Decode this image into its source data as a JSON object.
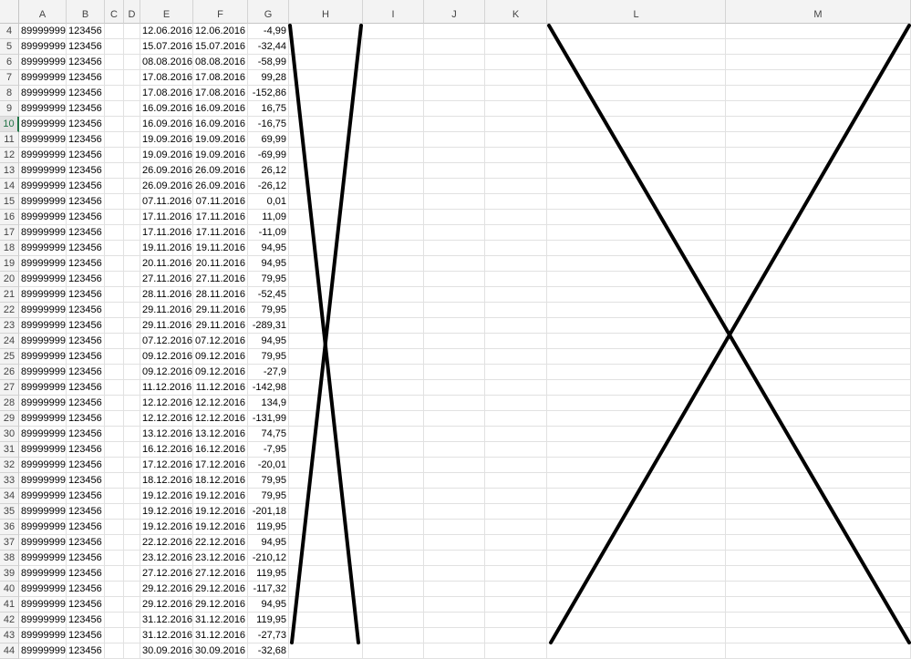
{
  "columns": [
    "A",
    "B",
    "C",
    "D",
    "E",
    "F",
    "G",
    "H",
    "I",
    "J",
    "K",
    "L",
    "M"
  ],
  "active_row": "10",
  "rows": [
    {
      "n": "4",
      "a": "89999999",
      "b": "123456",
      "e": "12.06.2016",
      "f": "12.06.2016",
      "g": "-4,99"
    },
    {
      "n": "5",
      "a": "89999999",
      "b": "123456",
      "e": "15.07.2016",
      "f": "15.07.2016",
      "g": "-32,44"
    },
    {
      "n": "6",
      "a": "89999999",
      "b": "123456",
      "e": "08.08.2016",
      "f": "08.08.2016",
      "g": "-58,99"
    },
    {
      "n": "7",
      "a": "89999999",
      "b": "123456",
      "e": "17.08.2016",
      "f": "17.08.2016",
      "g": "99,28"
    },
    {
      "n": "8",
      "a": "89999999",
      "b": "123456",
      "e": "17.08.2016",
      "f": "17.08.2016",
      "g": "-152,86"
    },
    {
      "n": "9",
      "a": "89999999",
      "b": "123456",
      "e": "16.09.2016",
      "f": "16.09.2016",
      "g": "16,75"
    },
    {
      "n": "10",
      "a": "89999999",
      "b": "123456",
      "e": "16.09.2016",
      "f": "16.09.2016",
      "g": "-16,75"
    },
    {
      "n": "11",
      "a": "89999999",
      "b": "123456",
      "e": "19.09.2016",
      "f": "19.09.2016",
      "g": "69,99"
    },
    {
      "n": "12",
      "a": "89999999",
      "b": "123456",
      "e": "19.09.2016",
      "f": "19.09.2016",
      "g": "-69,99"
    },
    {
      "n": "13",
      "a": "89999999",
      "b": "123456",
      "e": "26.09.2016",
      "f": "26.09.2016",
      "g": "26,12"
    },
    {
      "n": "14",
      "a": "89999999",
      "b": "123456",
      "e": "26.09.2016",
      "f": "26.09.2016",
      "g": "-26,12"
    },
    {
      "n": "15",
      "a": "89999999",
      "b": "123456",
      "e": "07.11.2016",
      "f": "07.11.2016",
      "g": "0,01"
    },
    {
      "n": "16",
      "a": "89999999",
      "b": "123456",
      "e": "17.11.2016",
      "f": "17.11.2016",
      "g": "11,09"
    },
    {
      "n": "17",
      "a": "89999999",
      "b": "123456",
      "e": "17.11.2016",
      "f": "17.11.2016",
      "g": "-11,09"
    },
    {
      "n": "18",
      "a": "89999999",
      "b": "123456",
      "e": "19.11.2016",
      "f": "19.11.2016",
      "g": "94,95"
    },
    {
      "n": "19",
      "a": "89999999",
      "b": "123456",
      "e": "20.11.2016",
      "f": "20.11.2016",
      "g": "94,95"
    },
    {
      "n": "20",
      "a": "89999999",
      "b": "123456",
      "e": "27.11.2016",
      "f": "27.11.2016",
      "g": "79,95"
    },
    {
      "n": "21",
      "a": "89999999",
      "b": "123456",
      "e": "28.11.2016",
      "f": "28.11.2016",
      "g": "-52,45"
    },
    {
      "n": "22",
      "a": "89999999",
      "b": "123456",
      "e": "29.11.2016",
      "f": "29.11.2016",
      "g": "79,95"
    },
    {
      "n": "23",
      "a": "89999999",
      "b": "123456",
      "e": "29.11.2016",
      "f": "29.11.2016",
      "g": "-289,31"
    },
    {
      "n": "24",
      "a": "89999999",
      "b": "123456",
      "e": "07.12.2016",
      "f": "07.12.2016",
      "g": "94,95"
    },
    {
      "n": "25",
      "a": "89999999",
      "b": "123456",
      "e": "09.12.2016",
      "f": "09.12.2016",
      "g": "79,95"
    },
    {
      "n": "26",
      "a": "89999999",
      "b": "123456",
      "e": "09.12.2016",
      "f": "09.12.2016",
      "g": "-27,9"
    },
    {
      "n": "27",
      "a": "89999999",
      "b": "123456",
      "e": "11.12.2016",
      "f": "11.12.2016",
      "g": "-142,98"
    },
    {
      "n": "28",
      "a": "89999999",
      "b": "123456",
      "e": "12.12.2016",
      "f": "12.12.2016",
      "g": "134,9"
    },
    {
      "n": "29",
      "a": "89999999",
      "b": "123456",
      "e": "12.12.2016",
      "f": "12.12.2016",
      "g": "-131,99"
    },
    {
      "n": "30",
      "a": "89999999",
      "b": "123456",
      "e": "13.12.2016",
      "f": "13.12.2016",
      "g": "74,75"
    },
    {
      "n": "31",
      "a": "89999999",
      "b": "123456",
      "e": "16.12.2016",
      "f": "16.12.2016",
      "g": "-7,95"
    },
    {
      "n": "32",
      "a": "89999999",
      "b": "123456",
      "e": "17.12.2016",
      "f": "17.12.2016",
      "g": "-20,01"
    },
    {
      "n": "33",
      "a": "89999999",
      "b": "123456",
      "e": "18.12.2016",
      "f": "18.12.2016",
      "g": "79,95"
    },
    {
      "n": "34",
      "a": "89999999",
      "b": "123456",
      "e": "19.12.2016",
      "f": "19.12.2016",
      "g": "79,95"
    },
    {
      "n": "35",
      "a": "89999999",
      "b": "123456",
      "e": "19.12.2016",
      "f": "19.12.2016",
      "g": "-201,18"
    },
    {
      "n": "36",
      "a": "89999999",
      "b": "123456",
      "e": "19.12.2016",
      "f": "19.12.2016",
      "g": "119,95"
    },
    {
      "n": "37",
      "a": "89999999",
      "b": "123456",
      "e": "22.12.2016",
      "f": "22.12.2016",
      "g": "94,95"
    },
    {
      "n": "38",
      "a": "89999999",
      "b": "123456",
      "e": "23.12.2016",
      "f": "23.12.2016",
      "g": "-210,12"
    },
    {
      "n": "39",
      "a": "89999999",
      "b": "123456",
      "e": "27.12.2016",
      "f": "27.12.2016",
      "g": "119,95"
    },
    {
      "n": "40",
      "a": "89999999",
      "b": "123456",
      "e": "29.12.2016",
      "f": "29.12.2016",
      "g": "-117,32"
    },
    {
      "n": "41",
      "a": "89999999",
      "b": "123456",
      "e": "29.12.2016",
      "f": "29.12.2016",
      "g": "94,95"
    },
    {
      "n": "42",
      "a": "89999999",
      "b": "123456",
      "e": "31.12.2016",
      "f": "31.12.2016",
      "g": "119,95"
    },
    {
      "n": "43",
      "a": "89999999",
      "b": "123456",
      "e": "31.12.2016",
      "f": "31.12.2016",
      "g": "-27,73"
    },
    {
      "n": "44",
      "a": "89999999",
      "b": "123456",
      "e": "30.09.2016",
      "f": "30.09.2016",
      "g": "-32,68"
    }
  ]
}
